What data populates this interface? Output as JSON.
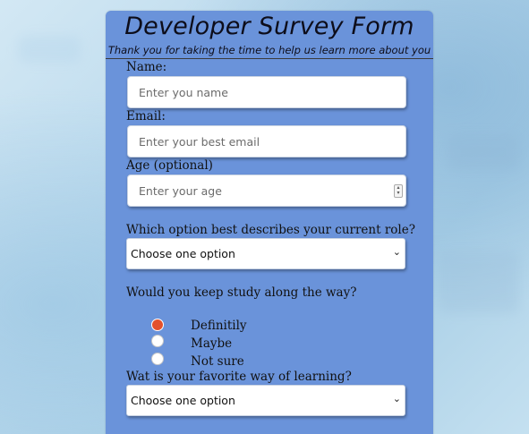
{
  "form": {
    "title": "Developer Survey Form",
    "description": "Thank you for taking the time to help us learn more about you",
    "name_label": "Name:",
    "name_placeholder": "Enter you name",
    "email_label": "Email:",
    "email_placeholder": "Enter your best email",
    "age_label": "Age (optional)",
    "age_placeholder": "Enter your age",
    "role_question": "Which option best describes your current role?",
    "role_selected": "Choose one option",
    "study_question": "Would you keep study along the way?",
    "study_options": [
      {
        "label": "Definitily",
        "checked": true
      },
      {
        "label": "Maybe",
        "checked": false
      },
      {
        "label": "Not sure",
        "checked": false
      }
    ],
    "learning_question": "Wat is your favorite way of learning?",
    "learning_selected": "Choose one option"
  },
  "colors": {
    "card": "#6a93da",
    "radio_checked": "#e2512d"
  },
  "icons": {
    "select_arrow": "chevron-down-icon",
    "number_spinner": "spinner-icon"
  }
}
